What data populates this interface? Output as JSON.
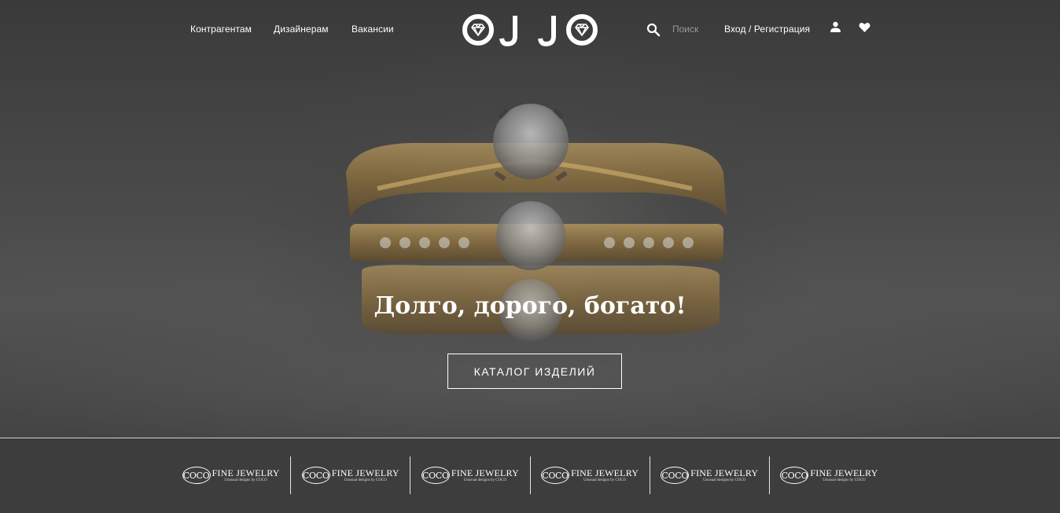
{
  "nav": {
    "links": [
      "Контрагентам",
      "Дизайнерам",
      "Вакансии"
    ]
  },
  "logo": {
    "text": "OJJO"
  },
  "search": {
    "placeholder": "Поиск"
  },
  "account": {
    "login_label": "Вход / Регистрация"
  },
  "hero": {
    "title": "Долго, дорого, богато!",
    "button_label": "КАТАЛОГ ИЗДЕЛИЙ"
  },
  "brands": [
    {
      "mark": "COCO",
      "name": "FINE JEWELRY",
      "tagline": "Unusual designs by COCO"
    },
    {
      "mark": "COCO",
      "name": "FINE JEWELRY",
      "tagline": "Unusual designs by COCO"
    },
    {
      "mark": "COCO",
      "name": "FINE JEWELRY",
      "tagline": "Unusual designs by COCO"
    },
    {
      "mark": "COCO",
      "name": "FINE JEWELRY",
      "tagline": "Unusual designs by COCO"
    },
    {
      "mark": "COCO",
      "name": "FINE JEWELRY",
      "tagline": "Unusual designs by COCO"
    },
    {
      "mark": "COCO",
      "name": "FINE JEWELRY",
      "tagline": "Unusual designs by COCO"
    }
  ],
  "icons": {
    "search": "search-icon",
    "user": "user-icon",
    "favorites": "heart-icon",
    "logo_gem": "diamond-icon"
  },
  "colors": {
    "background": "#3d3d3d",
    "text": "#ffffff",
    "ring_gold": "#a88a55"
  }
}
